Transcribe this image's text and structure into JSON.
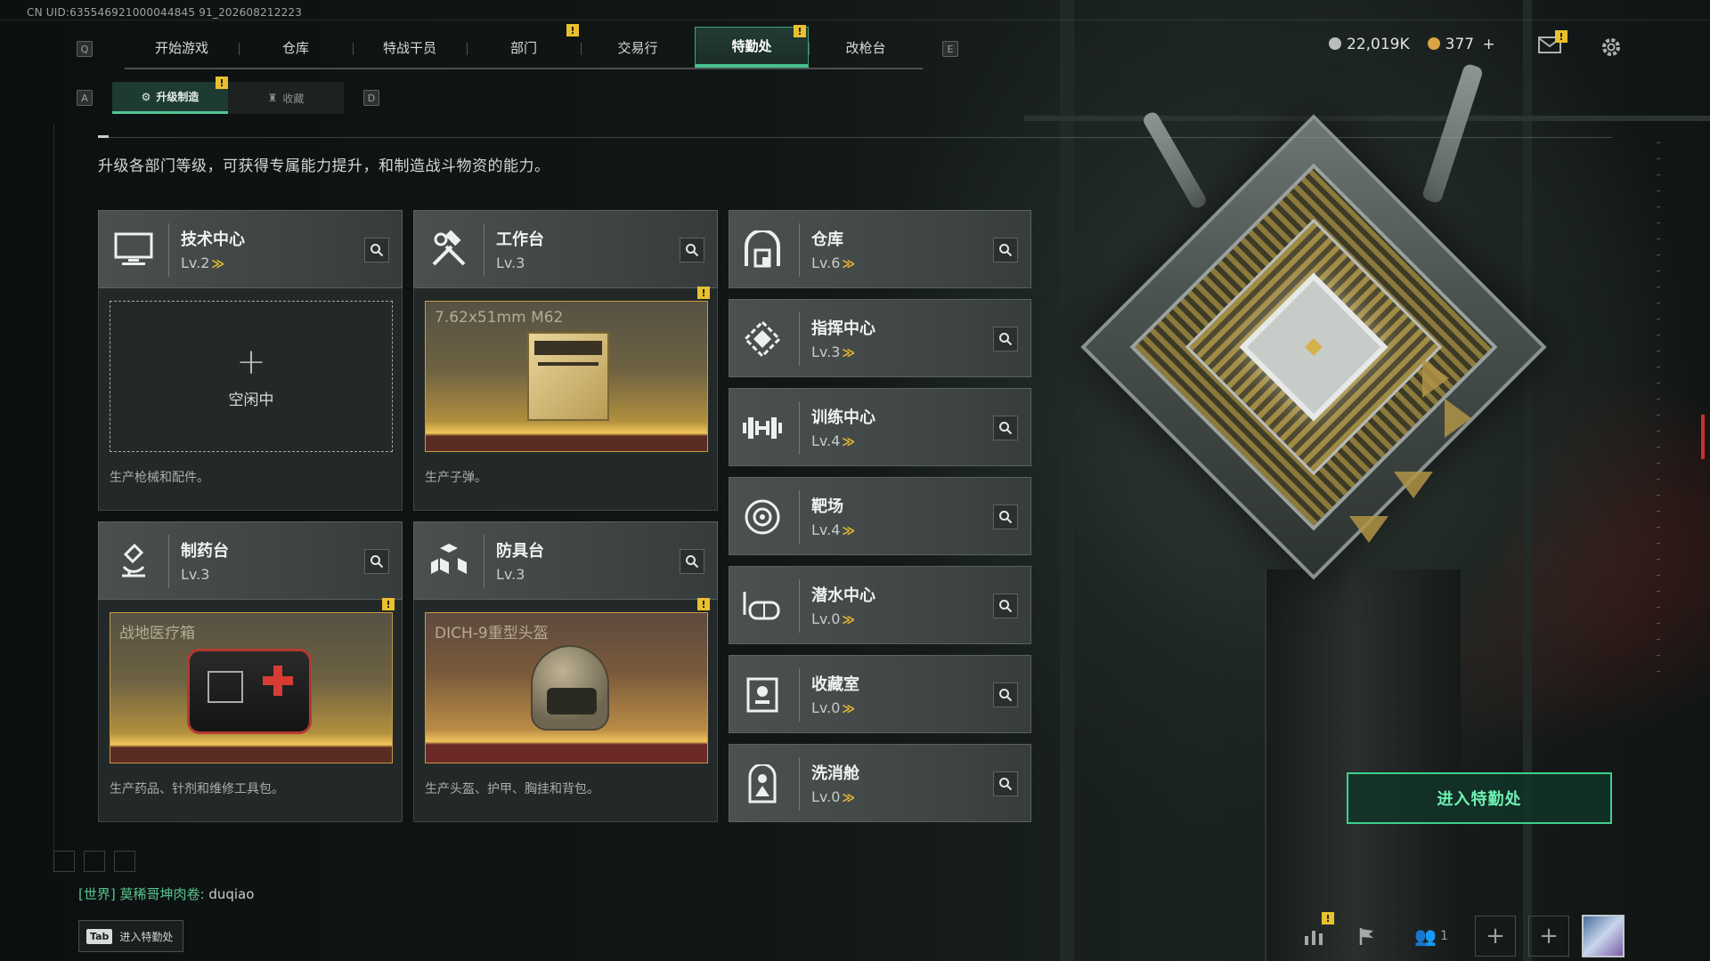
{
  "uid_text": "CN UID:635546921000044845 91_202608212223",
  "top_tabs": {
    "left_key": "Q",
    "right_key": "E",
    "items": [
      {
        "label": "开始游戏",
        "alert": false
      },
      {
        "label": "仓库",
        "alert": false
      },
      {
        "label": "特战干员",
        "alert": false
      },
      {
        "label": "部门",
        "alert": true
      },
      {
        "label": "交易行",
        "alert": false
      },
      {
        "label": "特勤处",
        "alert": true,
        "active": true
      },
      {
        "label": "改枪台",
        "alert": false
      }
    ]
  },
  "currency": {
    "silver": "22,019K",
    "gold": "377",
    "add_symbol": "+",
    "silver_color": "#b9bdbc",
    "gold_color": "#d9a441"
  },
  "sub_tabs": {
    "left_key": "A",
    "right_key": "D",
    "items": [
      {
        "label": "升级制造",
        "active": true,
        "alert": true
      },
      {
        "label": "收藏",
        "active": false,
        "alert": false
      }
    ]
  },
  "alert_mark": "!",
  "description": "升级各部门等级，可获得专属能力提升，和制造战斗物资的能力。",
  "level_prefix": "Lv.",
  "up_glyph": "≫",
  "production_cards": [
    {
      "name": "技术中心",
      "level": "2",
      "upgradable": true,
      "icon": "monitor-icon",
      "slot": {
        "state": "idle",
        "plus": "+",
        "text": "空闲中"
      },
      "footer": "生产枪械和配件。"
    },
    {
      "name": "工作台",
      "level": "3",
      "upgradable": false,
      "icon": "hammer-wrench-icon",
      "slot": {
        "state": "item",
        "text": "7.62x51mm M62",
        "alert": true,
        "item_icon": "ammo-box-icon"
      },
      "footer": "生产子弹。"
    },
    {
      "name": "制药台",
      "level": "3",
      "upgradable": false,
      "icon": "microscope-icon",
      "slot": {
        "state": "item",
        "text": "战地医疗箱",
        "alert": true,
        "item_icon": "medkit-icon"
      },
      "footer": "生产药品、针剂和维修工具包。"
    },
    {
      "name": "防具台",
      "level": "3",
      "upgradable": false,
      "icon": "cubes-icon",
      "slot": {
        "state": "item",
        "text": "DICH-9重型头盔",
        "alert": true,
        "item_icon": "helmet-icon"
      },
      "footer": "生产头盔、护甲、胸挂和背包。"
    }
  ],
  "departments": [
    {
      "name": "仓库",
      "level": "6",
      "upgradable": true,
      "icon": "warehouse-icon"
    },
    {
      "name": "指挥中心",
      "level": "3",
      "upgradable": true,
      "icon": "command-icon"
    },
    {
      "name": "训练中心",
      "level": "4",
      "upgradable": true,
      "icon": "dumbbell-icon"
    },
    {
      "name": "靶场",
      "level": "4",
      "upgradable": true,
      "icon": "target-icon"
    },
    {
      "name": "潜水中心",
      "level": "0",
      "upgradable": true,
      "icon": "diving-mask-icon"
    },
    {
      "name": "收藏室",
      "level": "0",
      "upgradable": true,
      "icon": "display-case-icon"
    },
    {
      "name": "洗消舱",
      "level": "0",
      "upgradable": true,
      "icon": "decon-suit-icon"
    }
  ],
  "enter_button": "进入特勤处",
  "chat": {
    "channel": "[世界]",
    "sender": "莫稀哥坤肉卷:",
    "message": "duqiao"
  },
  "tab_hint": {
    "key": "Tab",
    "label": "进入特勤处"
  },
  "bottom_bar": {
    "friends_count": "1"
  },
  "colors": {
    "accent_green": "#48c08f",
    "alert_yellow": "#e9c02e",
    "upgrade_gold": "#e9b830"
  }
}
